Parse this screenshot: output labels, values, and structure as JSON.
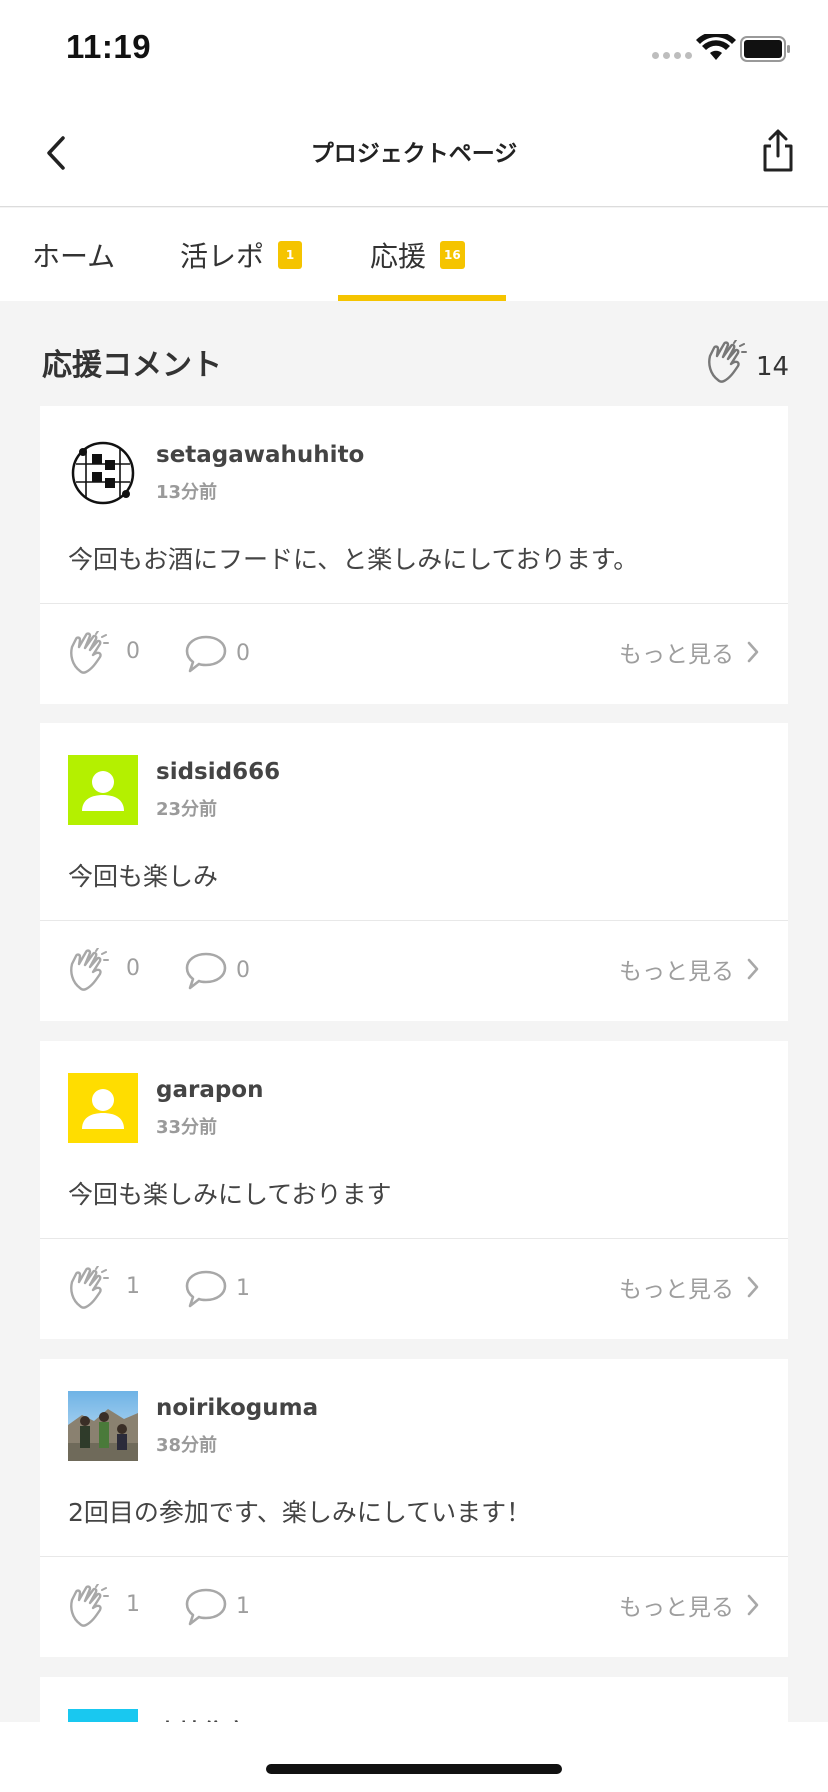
{
  "status_bar": {
    "time": "11:19"
  },
  "nav": {
    "title": "プロジェクトページ"
  },
  "tabs": [
    {
      "label": "ホーム",
      "badge": ""
    },
    {
      "label": "活レポ",
      "badge": "1"
    },
    {
      "label": "応援",
      "badge": "16",
      "active": true
    }
  ],
  "section": {
    "title": "応援コメント",
    "cheer_total": "14"
  },
  "comments": [
    {
      "username": "setagawahuhito",
      "posted": "13分前",
      "text": "今回もお酒にフードに、と楽しみにしております。",
      "claps": "0",
      "replies": "0",
      "more": "もっと見る",
      "avatar": "logo-seal"
    },
    {
      "username": "sidsid666",
      "posted": "23分前",
      "text": "今回も楽しみ",
      "claps": "0",
      "replies": "0",
      "more": "もっと見る",
      "avatar": "default-green"
    },
    {
      "username": "garapon",
      "posted": "33分前",
      "text": "今回も楽しみにしております",
      "claps": "1",
      "replies": "1",
      "more": "もっと見る",
      "avatar": "default-yellow"
    },
    {
      "username": "noirikoguma",
      "posted": "38分前",
      "text": "2回目の参加です、楽しみにしています！",
      "claps": "1",
      "replies": "1",
      "more": "もっと見る",
      "avatar": "photo"
    }
  ],
  "partial_card": {
    "username": "山地住商"
  },
  "colors": {
    "accent": "#f5c400",
    "avatar_green": "#b4f000",
    "avatar_yellow": "#ffdd00",
    "avatar_cyan": "#19c8f0"
  }
}
